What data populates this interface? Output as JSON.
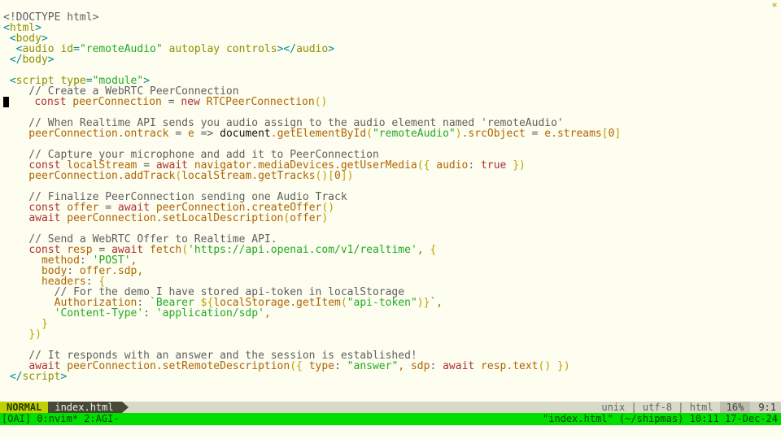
{
  "vim": {
    "mode": "NORMAL",
    "filename": "index.html",
    "encoding": "unix | utf-8 | html",
    "percent": "16%",
    "position": "9:1"
  },
  "tmux": {
    "left": "[OAI] 0:nvim* 2:AGI-",
    "right": "\"index.html\" (~/shipmas) 10:11 17-Dec-24"
  },
  "top_glyph": "*",
  "code": {
    "l01a": "<!",
    "l01b": "DOCTYPE html",
    "l01c": ">",
    "l02a": "<",
    "l02b": "html",
    "l02c": ">",
    "l03a": " <",
    "l03b": "body",
    "l03c": ">",
    "l04a": "  <",
    "l04b": "audio",
    "l04sp": " ",
    "l04c": "id",
    "l04eq": "=",
    "l04d": "\"remoteAudio\"",
    "l04e": " autoplay controls",
    "l04f": "></",
    "l04g": "audio",
    "l04h": ">",
    "l05a": " </",
    "l05b": "body",
    "l05c": ">",
    "l06": " ",
    "l07a": " <",
    "l07b": "script",
    "l07sp": " ",
    "l07c": "type",
    "l07eq": "=",
    "l07d": "\"module\"",
    "l07e": ">",
    "l08": "    // Create a WebRTC PeerConnection",
    "l09a": "    ",
    "l09b": "const",
    "l09c": " peerConnection ",
    "l09d": "=",
    "l09e": " ",
    "l09f": "new",
    "l09g": " RTCPeerConnection",
    "l09h": "()",
    "l10": " ",
    "l11": "    // When Realtime API sends you audio assign to the audio element named 'remoteAudio'",
    "l12a": "    peerConnection.ontrack ",
    "l12b": "=",
    "l12c": " e ",
    "l12d": "=>",
    "l12e": " ",
    "l12f": "document",
    "l12g": ".getElementById",
    "l12h": "(",
    "l12i": "\"remoteAudio\"",
    "l12j": ")",
    "l12k": ".srcObject ",
    "l12l": "=",
    "l12m": " e.streams",
    "l12n": "[",
    "l12o": "0",
    "l12p": "]",
    "l13": " ",
    "l14": "    // Capture your microphone and add it to PeerConnection",
    "l15a": "    ",
    "l15b": "const",
    "l15c": " localStream ",
    "l15d": "=",
    "l15e": " ",
    "l15f": "await",
    "l15g": " navigator.mediaDevices.getUserMedia",
    "l15h": "(",
    "l15i": "{",
    "l15j": " audio",
    "l15k": ":",
    "l15l": " ",
    "l15m": "true",
    "l15n": " ",
    "l15o": "}",
    "l15p": ")",
    "l16a": "    peerConnection.addTrack",
    "l16b": "(",
    "l16c": "localStream.getTracks",
    "l16d": "()[",
    "l16e": "0",
    "l16f": "])",
    "l17": " ",
    "l18": "    // Finalize PeerConnection sending one Audio Track",
    "l19a": "    ",
    "l19b": "const",
    "l19c": " offer ",
    "l19d": "=",
    "l19e": " ",
    "l19f": "await",
    "l19g": " peerConnection.createOffer",
    "l19h": "()",
    "l20a": "    ",
    "l20b": "await",
    "l20c": " peerConnection.setLocalDescription",
    "l20d": "(",
    "l20e": "offer",
    "l20f": ")",
    "l21": " ",
    "l22": "    // Send a WebRTC Offer to Realtime API.",
    "l23a": "    ",
    "l23b": "const",
    "l23c": " resp ",
    "l23d": "=",
    "l23e": " ",
    "l23f": "await",
    "l23g": " fetch",
    "l23h": "(",
    "l23i": "'https://api.openai.com/v1/realtime'",
    "l23j": ", ",
    "l23k": "{",
    "l24a": "      method",
    "l24b": ":",
    "l24c": " ",
    "l24d": "'POST'",
    "l24e": ",",
    "l25a": "      body",
    "l25b": ":",
    "l25c": " offer.sdp,",
    "l26a": "      headers",
    "l26b": ":",
    "l26c": " ",
    "l26d": "{",
    "l27": "        // For the demo I have stored api-token in localStorage",
    "l28a": "        Authorization",
    "l28b": ":",
    "l28c": " ",
    "l28d": "`Bearer ",
    "l28e": "${",
    "l28f": "localStorage.getItem",
    "l28g": "(",
    "l28h": "\"api-token\"",
    "l28i": ")",
    "l28j": "}",
    "l28k": "`",
    "l28l": ",",
    "l29a": "        ",
    "l29b": "'Content-Type'",
    "l29c": ":",
    "l29d": " ",
    "l29e": "'application/sdp'",
    "l29f": ",",
    "l30": "      }",
    "l31a": "    ",
    "l31b": "}",
    "l31c": ")",
    "l32": " ",
    "l33": "    // It responds with an answer and the session is established!",
    "l34a": "    ",
    "l34b": "await",
    "l34c": " peerConnection.setRemoteDescription",
    "l34d": "(",
    "l34e": "{",
    "l34f": " type",
    "l34g": ":",
    "l34h": " ",
    "l34i": "\"answer\"",
    "l34j": ", sdp",
    "l34k": ":",
    "l34l": " ",
    "l34m": "await",
    "l34n": " resp.text",
    "l34o": "() ",
    "l34p": "}",
    "l34q": ")",
    "l35a": " </",
    "l35b": "script",
    "l35c": ">"
  }
}
